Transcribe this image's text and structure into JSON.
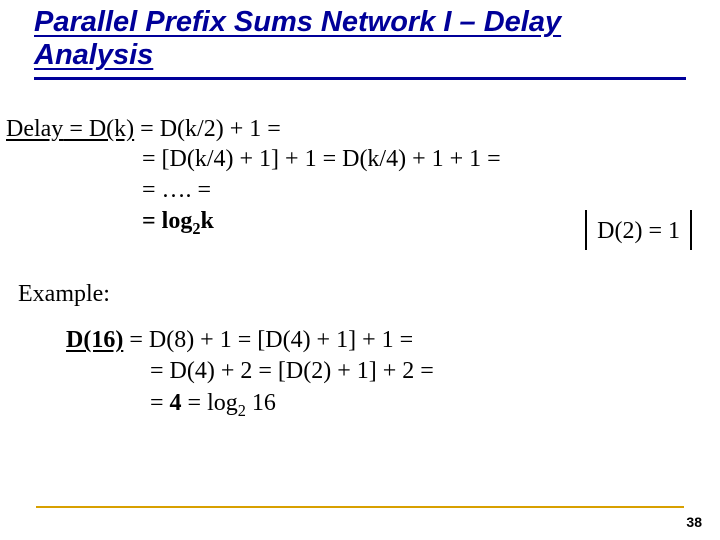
{
  "title": "Parallel Prefix Sums Network I – Delay Analysis",
  "delay": {
    "label": "Delay",
    "eq1_left": " = D(k)",
    "eq1_right": " = D(k/2) + 1 =",
    "eq2": "= [D(k/4) + 1] + 1 = D(k/4) + 1 + 1 =",
    "eq3": "= …. =",
    "eq4_prefix": "= log",
    "eq4_sub": "2",
    "eq4_suffix": "k"
  },
  "base_case": "D(2) = 1",
  "example_label": "Example:",
  "example": {
    "l1_left": "D(16)",
    "l1_right": " = D(8) + 1 = [D(4) + 1] + 1 =",
    "l2": "= D(4) + 2 =  [D(2) + 1] + 2 =",
    "l3_a": "= ",
    "l3_b": "4",
    "l3_c": " = log",
    "l3_sub": "2",
    "l3_d": " 16"
  },
  "page_number": "38"
}
